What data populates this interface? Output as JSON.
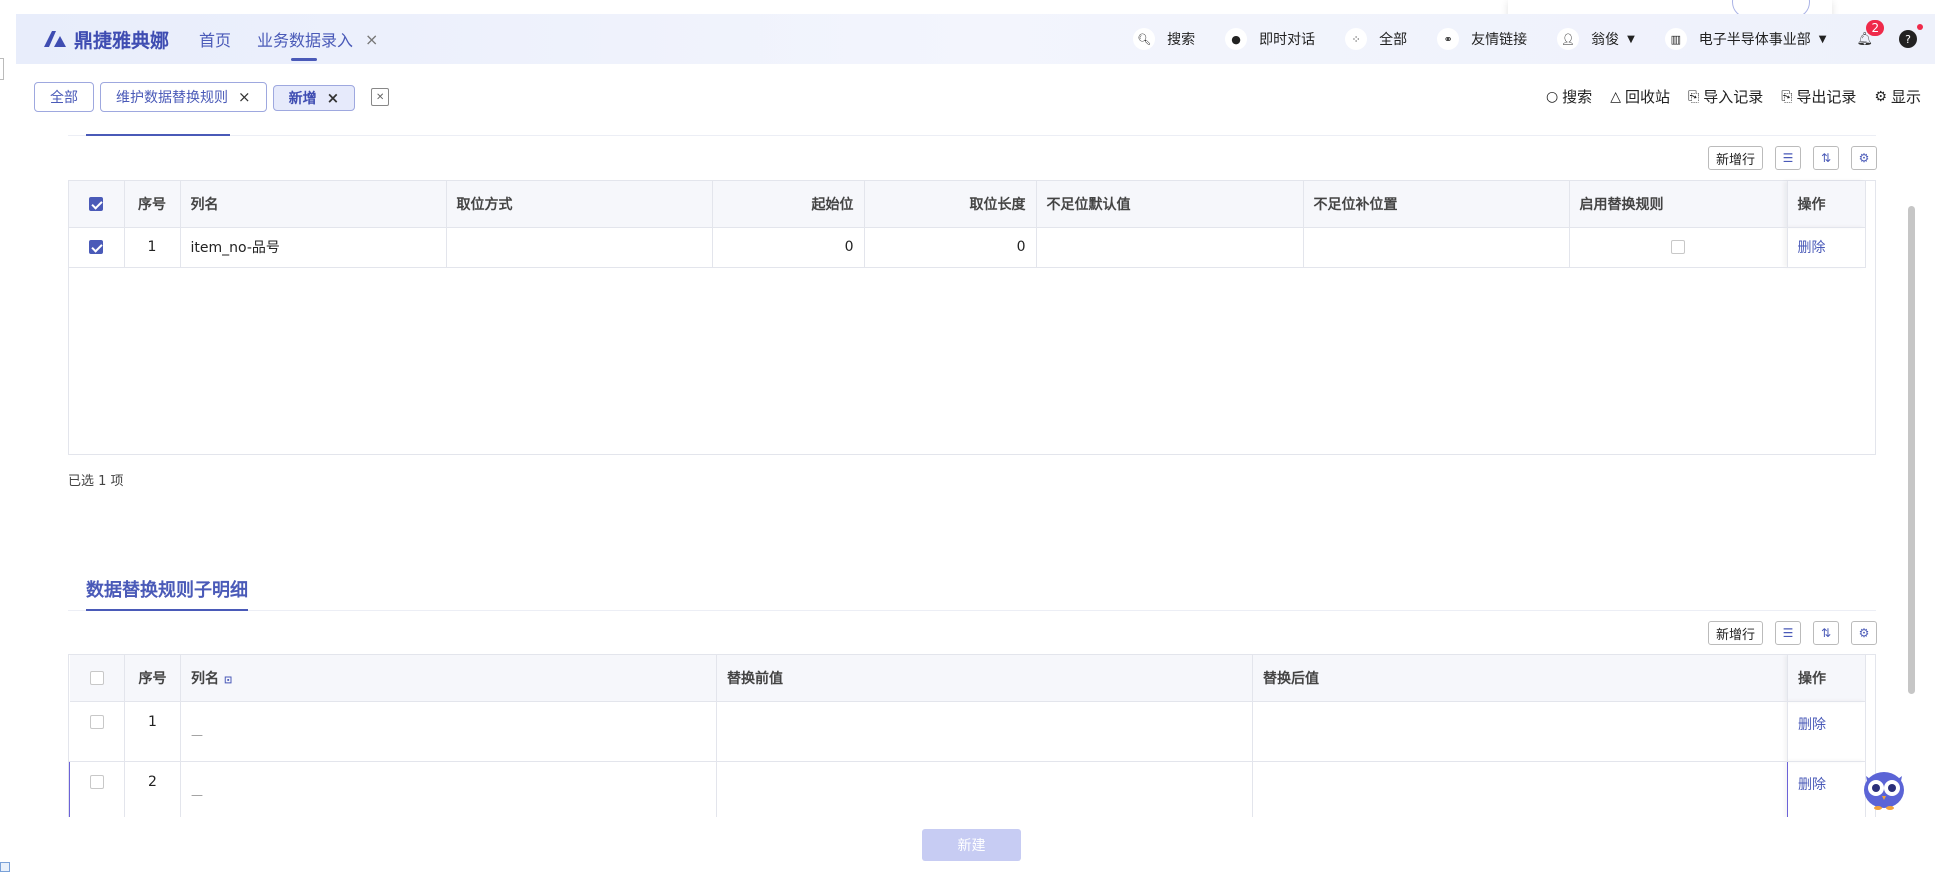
{
  "app": {
    "brand": "鼎捷雅典娜",
    "nav": [
      {
        "label": "首页"
      },
      {
        "label": "业务数据录入"
      }
    ],
    "header_buttons": [
      {
        "label": "搜索",
        "icon": "search-icon"
      },
      {
        "label": "即时对话",
        "icon": "chat-icon"
      },
      {
        "label": "全部",
        "icon": "grid-icon"
      },
      {
        "label": "友情链接",
        "icon": "link-icon"
      },
      {
        "label": "翁俊",
        "icon": "user-icon"
      },
      {
        "label": "电子半导体事业部",
        "icon": "building-icon"
      }
    ],
    "notification_count": "2",
    "accent": "#4a5ab8"
  },
  "tabs": [
    {
      "label": "全部"
    },
    {
      "label": "维护数据替换规则"
    },
    {
      "label": "新增"
    }
  ],
  "actions": [
    {
      "label": "搜索",
      "icon": "search-icon"
    },
    {
      "label": "回收站",
      "icon": "recycle-icon"
    },
    {
      "label": "导入记录",
      "icon": "import-icon"
    },
    {
      "label": "导出记录",
      "icon": "export-icon"
    },
    {
      "label": "显示",
      "icon": "display-icon"
    }
  ],
  "grid1": {
    "add_row": "新增行",
    "columns": [
      "序号",
      "列名",
      "取位方式",
      "起始位",
      "取位长度",
      "不足位默认值",
      "不足位补位置",
      "启用替换规则",
      "操作"
    ],
    "rows": [
      {
        "no": "1",
        "col": "item_no-品号",
        "mode": "",
        "start": "0",
        "len": "0",
        "default": "",
        "pad": "",
        "op": "删除"
      }
    ],
    "selected": "已选 1 项"
  },
  "grid2": {
    "title": "数据替换规则子明细",
    "add_row": "新增行",
    "columns": [
      "序号",
      "列名",
      "替换前值",
      "替换后值",
      "操作"
    ],
    "rows": [
      {
        "no": "1",
        "dash": "—",
        "op": "删除"
      },
      {
        "no": "2",
        "dash": "—",
        "op": "删除"
      }
    ]
  },
  "footer": {
    "create": "新建"
  }
}
